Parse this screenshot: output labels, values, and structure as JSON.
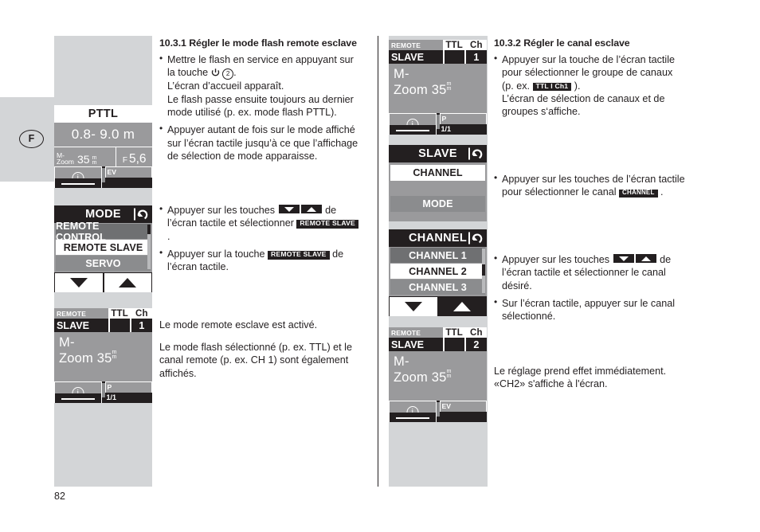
{
  "page": {
    "number": "82",
    "language_tag": "F"
  },
  "section_left": {
    "heading": "10.3.1 Régler le mode flash remote esclave",
    "bullets": [
      {
        "lines": [
          "Mettre le flash en service en appuyant sur",
          "la touche ",
          "L’écran d’accueil apparaît.",
          "Le flash passe ensuite toujours au dernier",
          "mode utilisé (p. ex. mode flash PTTL)."
        ],
        "icon": "power-icon",
        "callout": "2"
      },
      {
        "lines": [
          "Appuyer autant de fois sur le mode affiché",
          "sur l’écran tactile jusqu’à ce que l’affichage",
          "de sélection de mode apparaisse."
        ]
      },
      {
        "lines": [
          "Appuyer sur les touches ",
          " de",
          "l’écran tactile et sélectionner ",
          "."
        ],
        "chip": "REMOTE SLAVE"
      },
      {
        "lines": [
          "Appuyer sur la touche ",
          " de",
          "l’écran tactile."
        ],
        "chip": "REMOTE SLAVE"
      }
    ],
    "notes": [
      "Le mode remote esclave est activé.",
      "Le mode flash sélectionné (p. ex. TTL) et le canal remote (p. ex. CH 1) sont également affichés."
    ]
  },
  "section_right": {
    "heading": "10.3.2 Régler le canal esclave",
    "bullets": [
      {
        "lines": [
          "Appuyer sur la touche de l’écran tactile",
          "pour sélectionner le groupe de canaux",
          "(p. ex. ",
          ").",
          "L’écran de sélection de canaux et de",
          "groupes s‘affiche."
        ],
        "chip": "TTL I Ch1"
      },
      {
        "lines": [
          "Appuyer sur les touches de l’écran tactile",
          "pour sélectionner le canal ",
          "."
        ],
        "chip": "CHANNEL"
      },
      {
        "lines": [
          "Appuyer sur les touches ",
          " de",
          "l’écran tactile et sélectionner le canal",
          "désiré."
        ]
      },
      {
        "lines": [
          "Sur l’écran tactile, appuyer sur le canal",
          "sélectionné."
        ]
      }
    ],
    "notes": [
      "Le réglage prend effet immédiatement.",
      "«CH2» s'affiche à l'écran."
    ]
  },
  "screens": {
    "pttl": {
      "title": "PTTL",
      "distance": "0.8- 9.0 m",
      "zoom_label_top": "M-",
      "zoom_label_bottom": "Zoom",
      "zoom_value": "35",
      "zoom_unit_top": "m",
      "zoom_unit_bottom": "m",
      "aperture_label": "F",
      "aperture_value": "5,6",
      "info_icon": "info-icon",
      "ev_label": "EV"
    },
    "mode_menu": {
      "title": "MODE",
      "back_icon": "back-arrow-icon",
      "items": [
        {
          "label": "REMOTE CONTROL",
          "selected": false
        },
        {
          "label": "REMOTE SLAVE",
          "selected": true
        },
        {
          "label": "SERVO",
          "selected": false
        }
      ],
      "nav_down_icon": "triangle-down-icon",
      "nav_up_icon": "triangle-up-icon"
    },
    "slave_status_ch1": {
      "line1": "REMOTE",
      "line2": "SLAVE",
      "mode_top": "TTL",
      "mode_bottom": "",
      "ch_top": "Ch",
      "ch_bottom": "1",
      "zoom_line1": "M-",
      "zoom_line2": "Zoom",
      "zoom_value": "35",
      "zoom_unit_top": "m",
      "zoom_unit_bottom": "m",
      "info_icon": "info-icon",
      "p_label": "P",
      "p_value": "1/1"
    },
    "slave_status_ch1_top": {
      "line1": "REMOTE",
      "line2": "SLAVE",
      "mode_top": "TTL",
      "mode_bottom": "",
      "ch_top": "Ch",
      "ch_bottom": "1",
      "zoom_line1": "M-",
      "zoom_line2": "Zoom",
      "zoom_value": "35",
      "zoom_unit_top": "m",
      "zoom_unit_bottom": "m",
      "info_icon": "info-icon",
      "p_label": "P",
      "p_value": "1/1"
    },
    "slave_menu": {
      "title": "SLAVE",
      "back_icon": "back-arrow-icon",
      "items": [
        {
          "label": "CHANNEL",
          "selected": true
        },
        {
          "label": "MODE",
          "selected": false
        }
      ]
    },
    "channel_menu": {
      "title": "CHANNEL",
      "back_icon": "back-arrow-icon",
      "items": [
        {
          "label": "CHANNEL 1",
          "selected": false
        },
        {
          "label": "CHANNEL 2",
          "selected": true
        },
        {
          "label": "CHANNEL 3",
          "selected": false
        }
      ],
      "nav_down_icon": "triangle-down-icon",
      "nav_up_icon": "triangle-up-icon"
    },
    "slave_status_ch2": {
      "line1": "REMOTE",
      "line2": "SLAVE",
      "mode_top": "TTL",
      "mode_bottom": "",
      "ch_top": "Ch",
      "ch_bottom": "2",
      "zoom_line1": "M-",
      "zoom_line2": "Zoom",
      "zoom_value": "35",
      "zoom_unit_top": "m",
      "zoom_unit_bottom": "m",
      "info_icon": "info-icon",
      "ev_label": "EV"
    }
  },
  "colors": {
    "ink": "#231f20",
    "page_gray": "#d3d5d7",
    "lcd_gray": "#9a9a9c",
    "lcd_dark_item": "#6f7072"
  }
}
